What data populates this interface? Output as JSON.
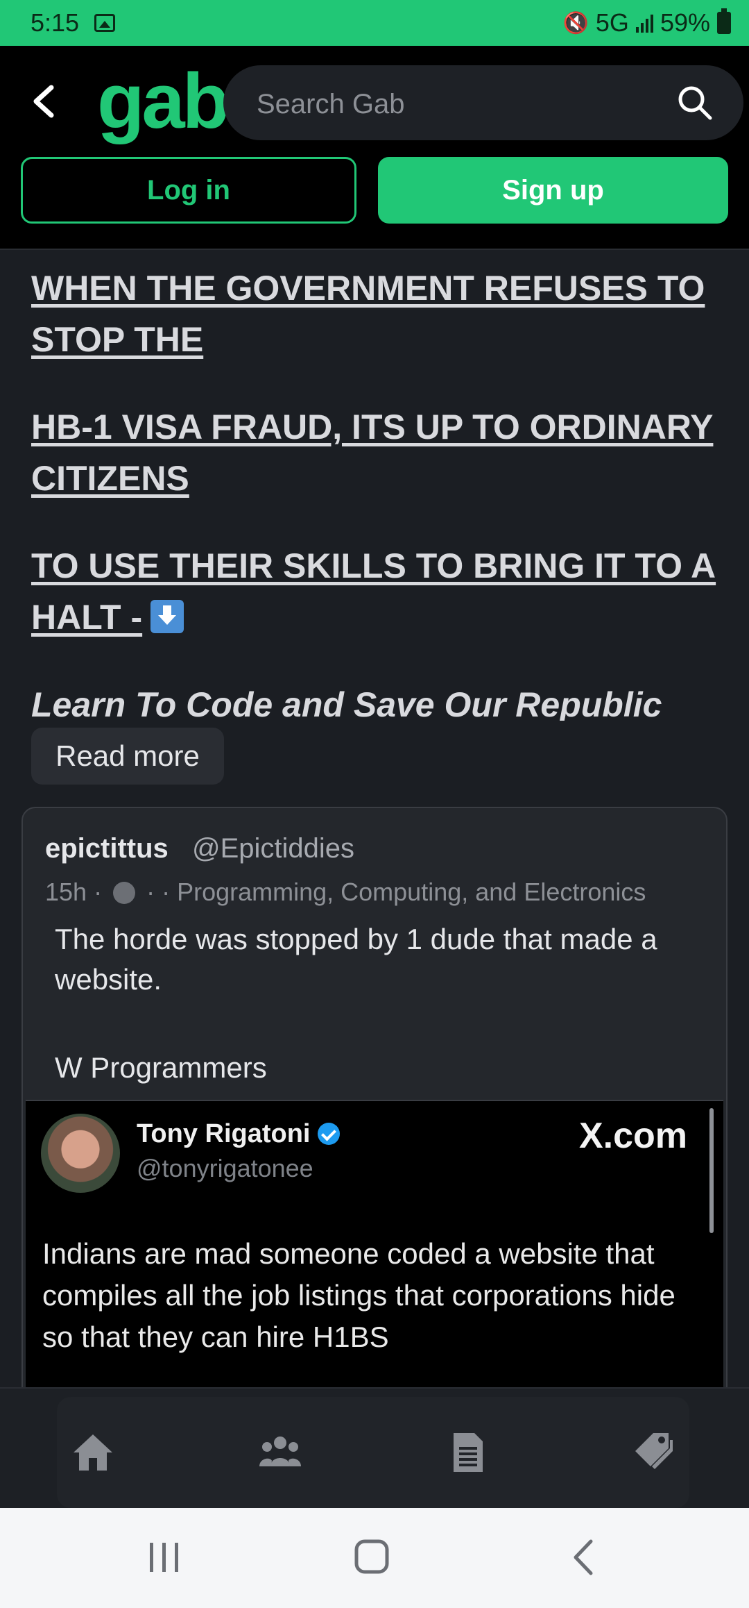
{
  "status_bar": {
    "time": "5:15",
    "network": "5G",
    "battery": "59%"
  },
  "header": {
    "logo": "gab",
    "search_placeholder": "Search Gab",
    "login_label": "Log in",
    "signup_label": "Sign up"
  },
  "post": {
    "lines": [
      "WHEN THE GOVERNMENT REFUSES TO STOP THE",
      "HB-1 VISA FRAUD, ITS UP TO ORDINARY CITIZENS",
      "TO USE THEIR SKILLS TO BRING IT TO A HALT -",
      "Learn To Code and Save Our Republic"
    ],
    "read_more": "Read more"
  },
  "quoted_post": {
    "author_name": "epictittus",
    "author_handle": "@Epictiddies",
    "time": "15h",
    "group": "Programming, Computing, and Electronics",
    "text": "The horde was stopped by 1 dude that made a website.",
    "text2": "W Programmers",
    "embed": {
      "name": "Tony Rigatoni",
      "handle": "@tonyrigatonee",
      "source": "X.com",
      "text": "Indians are mad someone coded a website that compiles all the job listings that corporations hide so that they can hire H1BS"
    }
  },
  "bottom_nav": {
    "icons": [
      "home-icon",
      "groups-icon",
      "news-icon",
      "marketplace-tag-icon"
    ]
  }
}
